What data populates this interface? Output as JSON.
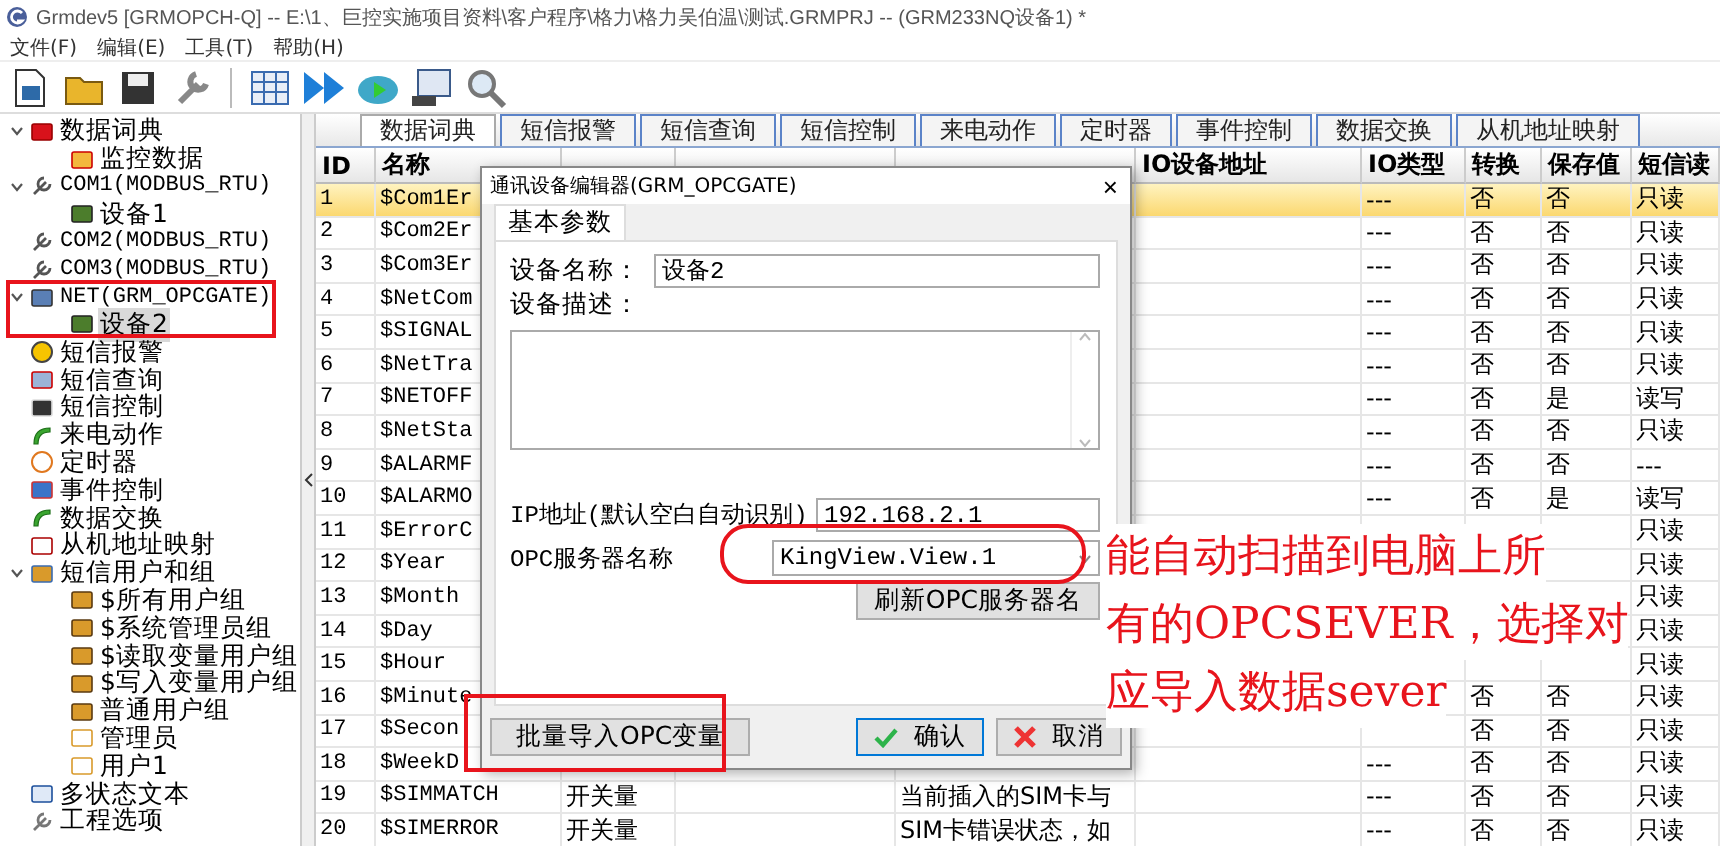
{
  "window": {
    "title": "Grmdev5 [GRMOPCH-Q]  -- E:\\1、巨控实施项目资料\\客户程序\\格力\\格力吴伯温\\测试.GRMPRJ -- (GRM233NQ设备1) *"
  },
  "menu": [
    "文件(F)",
    "编辑(E)",
    "工具(T)",
    "帮助(H)"
  ],
  "tree": [
    {
      "label": "数据词典",
      "kind": "book",
      "expanded": true,
      "selected": false,
      "children": [
        {
          "label": "监控数据",
          "kind": "folder",
          "selected": false
        }
      ]
    },
    {
      "label": "COM1(MODBUS_RTU)",
      "kind": "port",
      "expanded": true,
      "selected": false,
      "children": [
        {
          "label": "设备1",
          "kind": "device",
          "selected": false
        }
      ]
    },
    {
      "label": "COM2(MODBUS_RTU)",
      "kind": "port",
      "selected": false
    },
    {
      "label": "COM3(MODBUS_RTU)",
      "kind": "port",
      "selected": false
    },
    {
      "label": "NET(GRM_OPCGATE)",
      "kind": "net",
      "expanded": true,
      "selected": false,
      "children": [
        {
          "label": "设备2",
          "kind": "device",
          "selected": true
        }
      ]
    },
    {
      "label": "短信报警",
      "kind": "bell",
      "selected": false
    },
    {
      "label": "短信查询",
      "kind": "query",
      "selected": false
    },
    {
      "label": "短信控制",
      "kind": "cmd",
      "selected": false
    },
    {
      "label": "来电动作",
      "kind": "phone",
      "selected": false
    },
    {
      "label": "定时器",
      "kind": "timer",
      "selected": false
    },
    {
      "label": "事件控制",
      "kind": "event",
      "selected": false
    },
    {
      "label": "数据交换",
      "kind": "exchange",
      "selected": false
    },
    {
      "label": "从机地址映射",
      "kind": "map",
      "selected": false
    },
    {
      "label": "短信用户和组",
      "kind": "users",
      "expanded": true,
      "selected": false,
      "children": [
        {
          "label": "$所有用户组",
          "kind": "group",
          "selected": false
        },
        {
          "label": "$系统管理员组",
          "kind": "group",
          "selected": false
        },
        {
          "label": "$读取变量用户组",
          "kind": "group",
          "selected": false
        },
        {
          "label": "$写入变量用户组",
          "kind": "group",
          "selected": false
        },
        {
          "label": "普通用户组",
          "kind": "group",
          "selected": false
        },
        {
          "label": "管理员",
          "kind": "user",
          "selected": false
        },
        {
          "label": "用户1",
          "kind": "user",
          "selected": false
        }
      ]
    },
    {
      "label": "多状态文本",
      "kind": "text",
      "selected": false
    },
    {
      "label": "工程选项",
      "kind": "wrench",
      "selected": false
    }
  ],
  "tabs": [
    {
      "label": "数据词典",
      "selected": true
    },
    {
      "label": "短信报警",
      "selected": false
    },
    {
      "label": "短信查询",
      "selected": false
    },
    {
      "label": "短信控制",
      "selected": false
    },
    {
      "label": "来电动作",
      "selected": false
    },
    {
      "label": "定时器",
      "selected": false
    },
    {
      "label": "事件控制",
      "selected": false
    },
    {
      "label": "数据交换",
      "selected": false
    },
    {
      "label": "从机地址映射",
      "selected": false
    }
  ],
  "table": {
    "columns": [
      "ID",
      "名称",
      null,
      null,
      null,
      "IO设备地址",
      "IO类型",
      "转换",
      "保存值",
      "短信读"
    ],
    "rows": [
      {
        "selected": true,
        "id": "1",
        "name": "$Com1Er",
        "io_type": "---",
        "convert": "否",
        "save": "否",
        "sms": "只读"
      },
      {
        "selected": false,
        "id": "2",
        "name": "$Com2Er",
        "io_type": "---",
        "convert": "否",
        "save": "否",
        "sms": "只读"
      },
      {
        "selected": false,
        "id": "3",
        "name": "$Com3Er",
        "io_type": "---",
        "convert": "否",
        "save": "否",
        "sms": "只读"
      },
      {
        "selected": false,
        "id": "4",
        "name": "$NetCom",
        "io_type": "---",
        "convert": "否",
        "save": "否",
        "sms": "只读"
      },
      {
        "selected": false,
        "id": "5",
        "name": "$SIGNAL",
        "io_type": "---",
        "convert": "否",
        "save": "否",
        "sms": "只读"
      },
      {
        "selected": false,
        "id": "6",
        "name": "$NetTra",
        "io_type": "---",
        "convert": "否",
        "save": "否",
        "sms": "只读"
      },
      {
        "selected": false,
        "id": "7",
        "name": "$NETOFF",
        "io_type": "---",
        "convert": "否",
        "save": "是",
        "sms": "读写"
      },
      {
        "selected": false,
        "id": "8",
        "name": "$NetSta",
        "io_type": "---",
        "convert": "否",
        "save": "否",
        "sms": "只读"
      },
      {
        "selected": false,
        "id": "9",
        "name": "$ALARMF",
        "io_type": "---",
        "convert": "否",
        "save": "否",
        "sms": "---"
      },
      {
        "selected": false,
        "id": "10",
        "name": "$ALARMO",
        "io_type": "---",
        "convert": "否",
        "save": "是",
        "sms": "读写"
      },
      {
        "selected": false,
        "id": "11",
        "name": "$ErrorC",
        "sms": "只读"
      },
      {
        "selected": false,
        "id": "12",
        "name": "$Year",
        "sms": "只读"
      },
      {
        "selected": false,
        "id": "13",
        "name": "$Month",
        "sms": "只读"
      },
      {
        "selected": false,
        "id": "14",
        "name": "$Day",
        "sms": "只读"
      },
      {
        "selected": false,
        "id": "15",
        "name": "$Hour",
        "sms": "只读"
      },
      {
        "selected": false,
        "id": "16",
        "name": "$Minute",
        "convert": "否",
        "save": "否",
        "sms": "只读"
      },
      {
        "selected": false,
        "id": "17",
        "name": "$Secon",
        "convert": "否",
        "save": "否",
        "sms": "只读"
      },
      {
        "selected": false,
        "id": "18",
        "name": "$WeekD",
        "io_type": "---",
        "convert": "否",
        "save": "否",
        "sms": "只读"
      },
      {
        "selected": false,
        "id": "19",
        "name": "$SIMMATCH",
        "type": "开关量",
        "desc": "当前插入的SIM卡与",
        "io_type": "---",
        "convert": "否",
        "save": "否",
        "sms": "只读"
      },
      {
        "selected": false,
        "id": "20",
        "name": "$SIMERROR",
        "type": "开关量",
        "desc": "SIM卡错误状态，如",
        "io_type": "---",
        "convert": "否",
        "save": "否",
        "sms": "只读"
      }
    ]
  },
  "dialog": {
    "title": "通讯设备编辑器(GRM_OPCGATE)",
    "close": "×",
    "tab": "基本参数",
    "device_name_label": "设备名称：",
    "device_name": "设备2",
    "description_label": "设备描述：",
    "ip_label": "IP地址(默认空白自动识别)",
    "ip": "192.168.2.1",
    "opc_label": "OPC服务器名称",
    "opc_server": "KingView.View.1",
    "refresh_button": "刷新OPC服务器名",
    "import_button": "批量导入OPC变量",
    "ok_button": "确认",
    "cancel_button": "取消"
  },
  "annotation": {
    "lines": [
      "能自动扫描到电脑上所",
      "有的OPCSEVER，选择对",
      "应导入数据sever"
    ]
  }
}
